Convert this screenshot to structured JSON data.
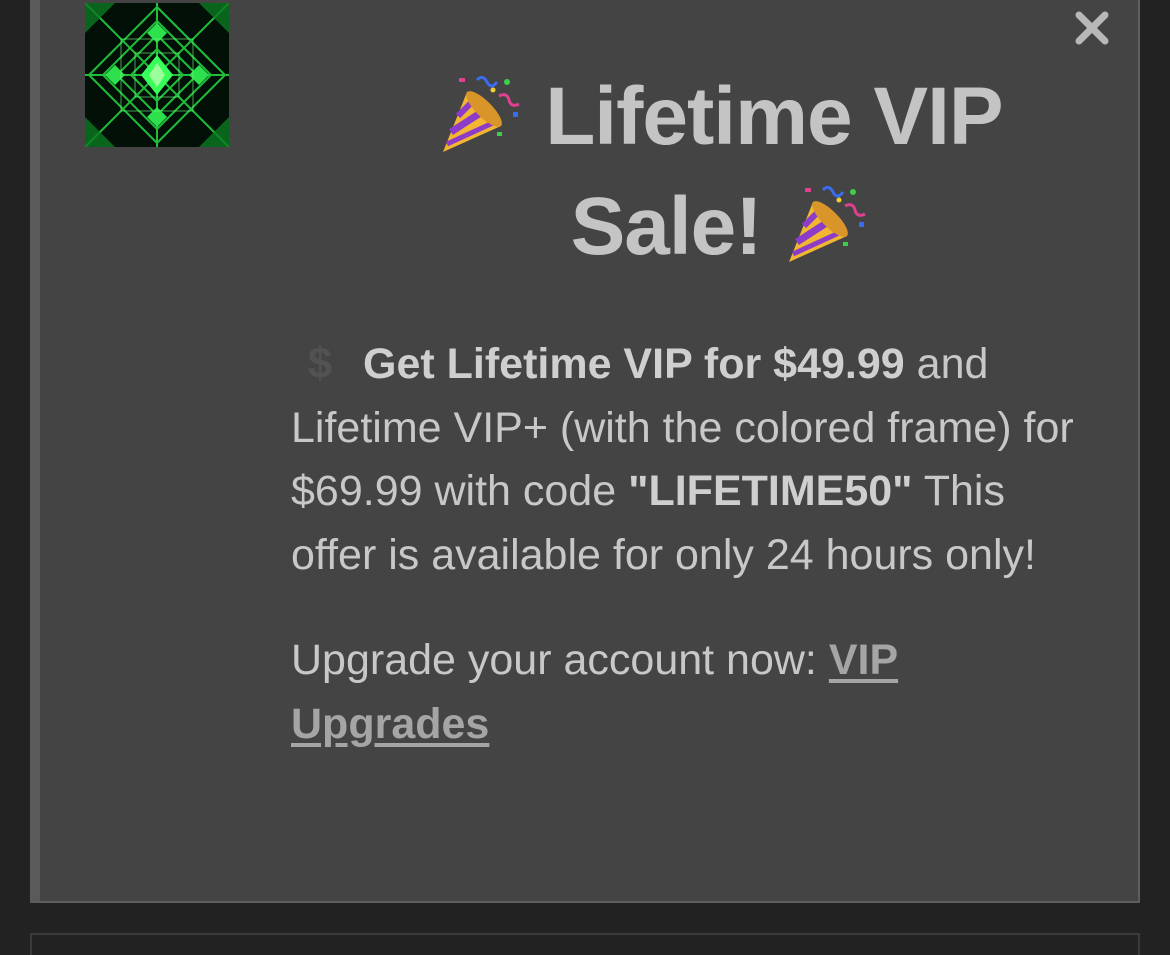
{
  "modal": {
    "logo_icon": "green-diamond-pattern-logo",
    "close_icon": "close-icon",
    "title_line1": "Lifetime VIP",
    "title_line2": "Sale!",
    "title_emoji": "party-popper",
    "body": {
      "dollar_icon": "$",
      "offer_bold": "Get Lifetime VIP for $49.99",
      "offer_text_1": " and Lifetime VIP+ (with the colored frame) for $69.99 with code ",
      "code": "\"LIFETIME50\"",
      "offer_text_2": " This offer is available for only 24 hours only!",
      "upgrade_prefix": "Upgrade your account now: ",
      "upgrade_link": "VIP Upgrades"
    }
  },
  "colors": {
    "background": "#222222",
    "modal_bg": "#444444",
    "text": "#c8c8c8",
    "link": "#a5a5a5"
  }
}
